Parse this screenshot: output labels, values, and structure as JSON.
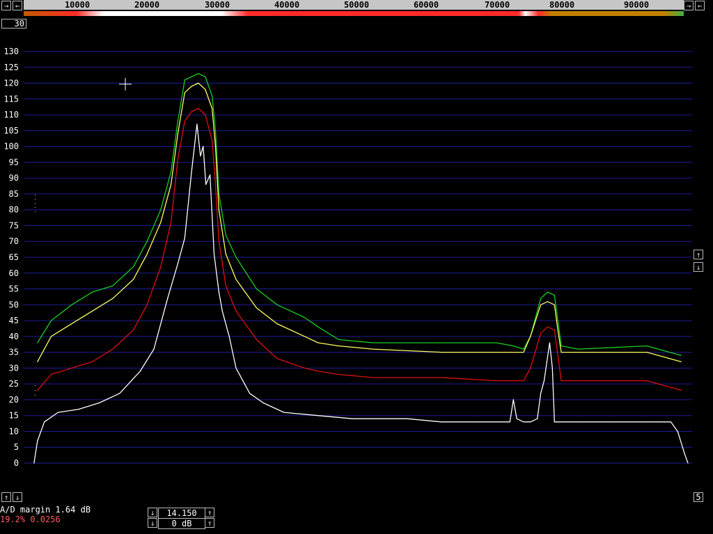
{
  "top_scale": {
    "ticks": [
      "10000",
      "20000",
      "30000",
      "40000",
      "50000",
      "60000",
      "70000",
      "80000",
      "90000"
    ],
    "left_buttons": [
      "→",
      "←"
    ],
    "right_buttons": [
      "→",
      "←"
    ]
  },
  "averaging_box": "30",
  "right_box": "5",
  "status": {
    "ad_margin": "A/D margin 1.64 dB",
    "error_rate": "19.2% 0.0256"
  },
  "controls": {
    "value1": "14.150",
    "value2": "0 dB"
  },
  "colors": {
    "grid": "#1d1d9a",
    "trace_green": "#18d020",
    "trace_yellow": "#ffff60",
    "trace_red": "#e01010",
    "trace_white": "#ffffff"
  },
  "chart_data": {
    "type": "line",
    "title": "",
    "xlabel": "",
    "ylabel": "",
    "xlim": [
      0,
      96000
    ],
    "ylim": [
      -5,
      135
    ],
    "y_ticks": [
      0,
      5,
      10,
      15,
      20,
      25,
      30,
      35,
      40,
      45,
      50,
      55,
      60,
      65,
      70,
      75,
      80,
      85,
      90,
      95,
      100,
      105,
      110,
      115,
      120,
      125,
      130
    ],
    "series": [
      {
        "color": "green",
        "x": [
          1000,
          3000,
          6000,
          9000,
          12000,
          15000,
          17000,
          19000,
          20500,
          21500,
          22500,
          23500,
          24500,
          25500,
          26500,
          27000,
          27500,
          28500,
          30000,
          33000,
          36000,
          40000,
          42000,
          45000,
          50000,
          60000,
          68000,
          70500,
          72000,
          73000,
          74500,
          75500,
          76500,
          77000,
          77500,
          80000,
          90000,
          95000
        ],
        "y": [
          38,
          45,
          50,
          54,
          56,
          62,
          70,
          80,
          92,
          108,
          121,
          122,
          123,
          122,
          116,
          105,
          85,
          72,
          65,
          55,
          50,
          46,
          43,
          39,
          38,
          38,
          38,
          37,
          36,
          40,
          52,
          54,
          53,
          45,
          37,
          36,
          37,
          34
        ]
      },
      {
        "color": "yellow",
        "x": [
          1000,
          3000,
          6000,
          9000,
          12000,
          15000,
          17000,
          19000,
          20500,
          21500,
          22500,
          23500,
          24500,
          25500,
          26500,
          27000,
          27500,
          28500,
          30000,
          33000,
          36000,
          40000,
          42000,
          45000,
          50000,
          60000,
          68000,
          70500,
          72000,
          73000,
          74500,
          75500,
          76500,
          77000,
          77500,
          80000,
          90000,
          95000
        ],
        "y": [
          32,
          40,
          44,
          48,
          52,
          58,
          66,
          76,
          88,
          104,
          117,
          119,
          120,
          118,
          112,
          100,
          80,
          66,
          58,
          49,
          44,
          40,
          38,
          37,
          36,
          35,
          35,
          35,
          35,
          40,
          50,
          51,
          50,
          42,
          35,
          35,
          35,
          32
        ]
      },
      {
        "color": "red",
        "x": [
          1000,
          3000,
          6000,
          9000,
          12000,
          15000,
          17000,
          19000,
          20500,
          21500,
          22500,
          23500,
          24500,
          25500,
          26500,
          27000,
          27500,
          28500,
          30000,
          33000,
          36000,
          40000,
          42000,
          45000,
          50000,
          60000,
          68000,
          70500,
          72000,
          73000,
          74500,
          75500,
          76500,
          77000,
          77500,
          80000,
          90000,
          95000
        ],
        "y": [
          23,
          28,
          30,
          32,
          36,
          42,
          50,
          62,
          76,
          96,
          108,
          111,
          112,
          110,
          102,
          88,
          70,
          56,
          48,
          39,
          33,
          30,
          29,
          28,
          27,
          27,
          26,
          26,
          26,
          30,
          41,
          43,
          42,
          34,
          26,
          26,
          26,
          23
        ]
      },
      {
        "color": "white",
        "x": [
          500,
          1000,
          2000,
          4000,
          7000,
          10000,
          13000,
          16000,
          18000,
          20000,
          21500,
          22500,
          23500,
          24300,
          24800,
          25200,
          25600,
          26200,
          26800,
          27500,
          28000,
          29000,
          30000,
          32000,
          34000,
          37000,
          42000,
          47000,
          50000,
          55000,
          60000,
          65000,
          70000,
          70500,
          71000,
          72000,
          73000,
          74000,
          74500,
          75000,
          75400,
          75800,
          76200,
          76500,
          77000,
          80000,
          85000,
          90000,
          92000,
          93500,
          94500,
          95500,
          96000
        ],
        "y": [
          0,
          7,
          13,
          16,
          17,
          19,
          22,
          29,
          36,
          52,
          63,
          71,
          92,
          107,
          97,
          100,
          88,
          91,
          66,
          54,
          48,
          40,
          30,
          22,
          19,
          16,
          15,
          14,
          14,
          14,
          13,
          13,
          13,
          20,
          14,
          13,
          13,
          14,
          22,
          26,
          32,
          38,
          30,
          13,
          13,
          13,
          13,
          13,
          13,
          13,
          10,
          3,
          0
        ]
      }
    ]
  }
}
